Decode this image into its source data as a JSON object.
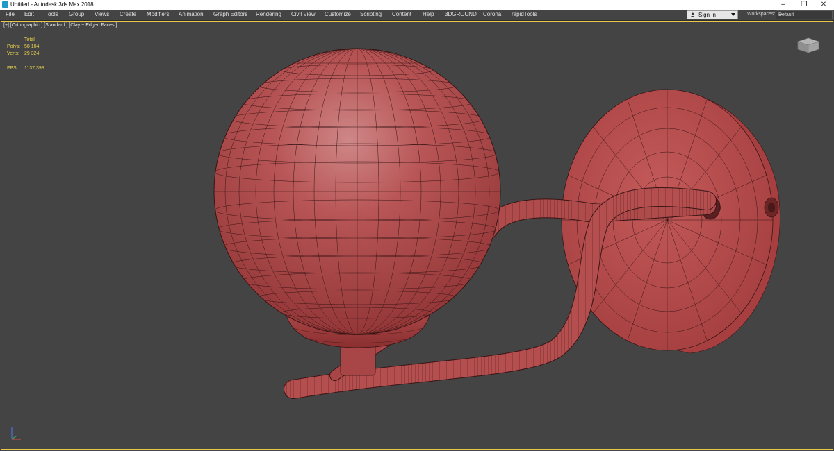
{
  "window": {
    "title": "Untitled - Autodesk 3ds Max 2018",
    "minimize": "–",
    "restore": "❐",
    "close": "✕"
  },
  "menu": {
    "items": [
      "File",
      "Edit",
      "Tools",
      "Group",
      "Views",
      "Create",
      "Modifiers",
      "Animation",
      "Graph Editors",
      "Rendering",
      "Civil View",
      "Customize",
      "Scripting",
      "Content",
      "Help",
      "3DGROUND",
      "Corona",
      "rapidTools"
    ],
    "sign_in": "Sign In",
    "workspaces_label": "Workspaces:",
    "workspace_value": "Default"
  },
  "viewport": {
    "label": "[+] [Orthographic ] [Standard ] [Clay + Edged Faces ]",
    "stats": {
      "total_label": "Total",
      "polys_label": "Polys:",
      "polys_value": "58 104",
      "verts_label": "Verts:",
      "verts_value": "29 324",
      "fps_label": "FPS:",
      "fps_value": "1137,398"
    }
  },
  "colors": {
    "viewport_bg": "#444444",
    "clay": "#b9494a",
    "active_border": "#e9c84a",
    "stats_text": "#e8d24f"
  },
  "icons": {
    "app": "3ds-max-icon",
    "viewcube": "viewcube-icon",
    "axis": "axis-tripod-icon",
    "user": "user-icon"
  }
}
